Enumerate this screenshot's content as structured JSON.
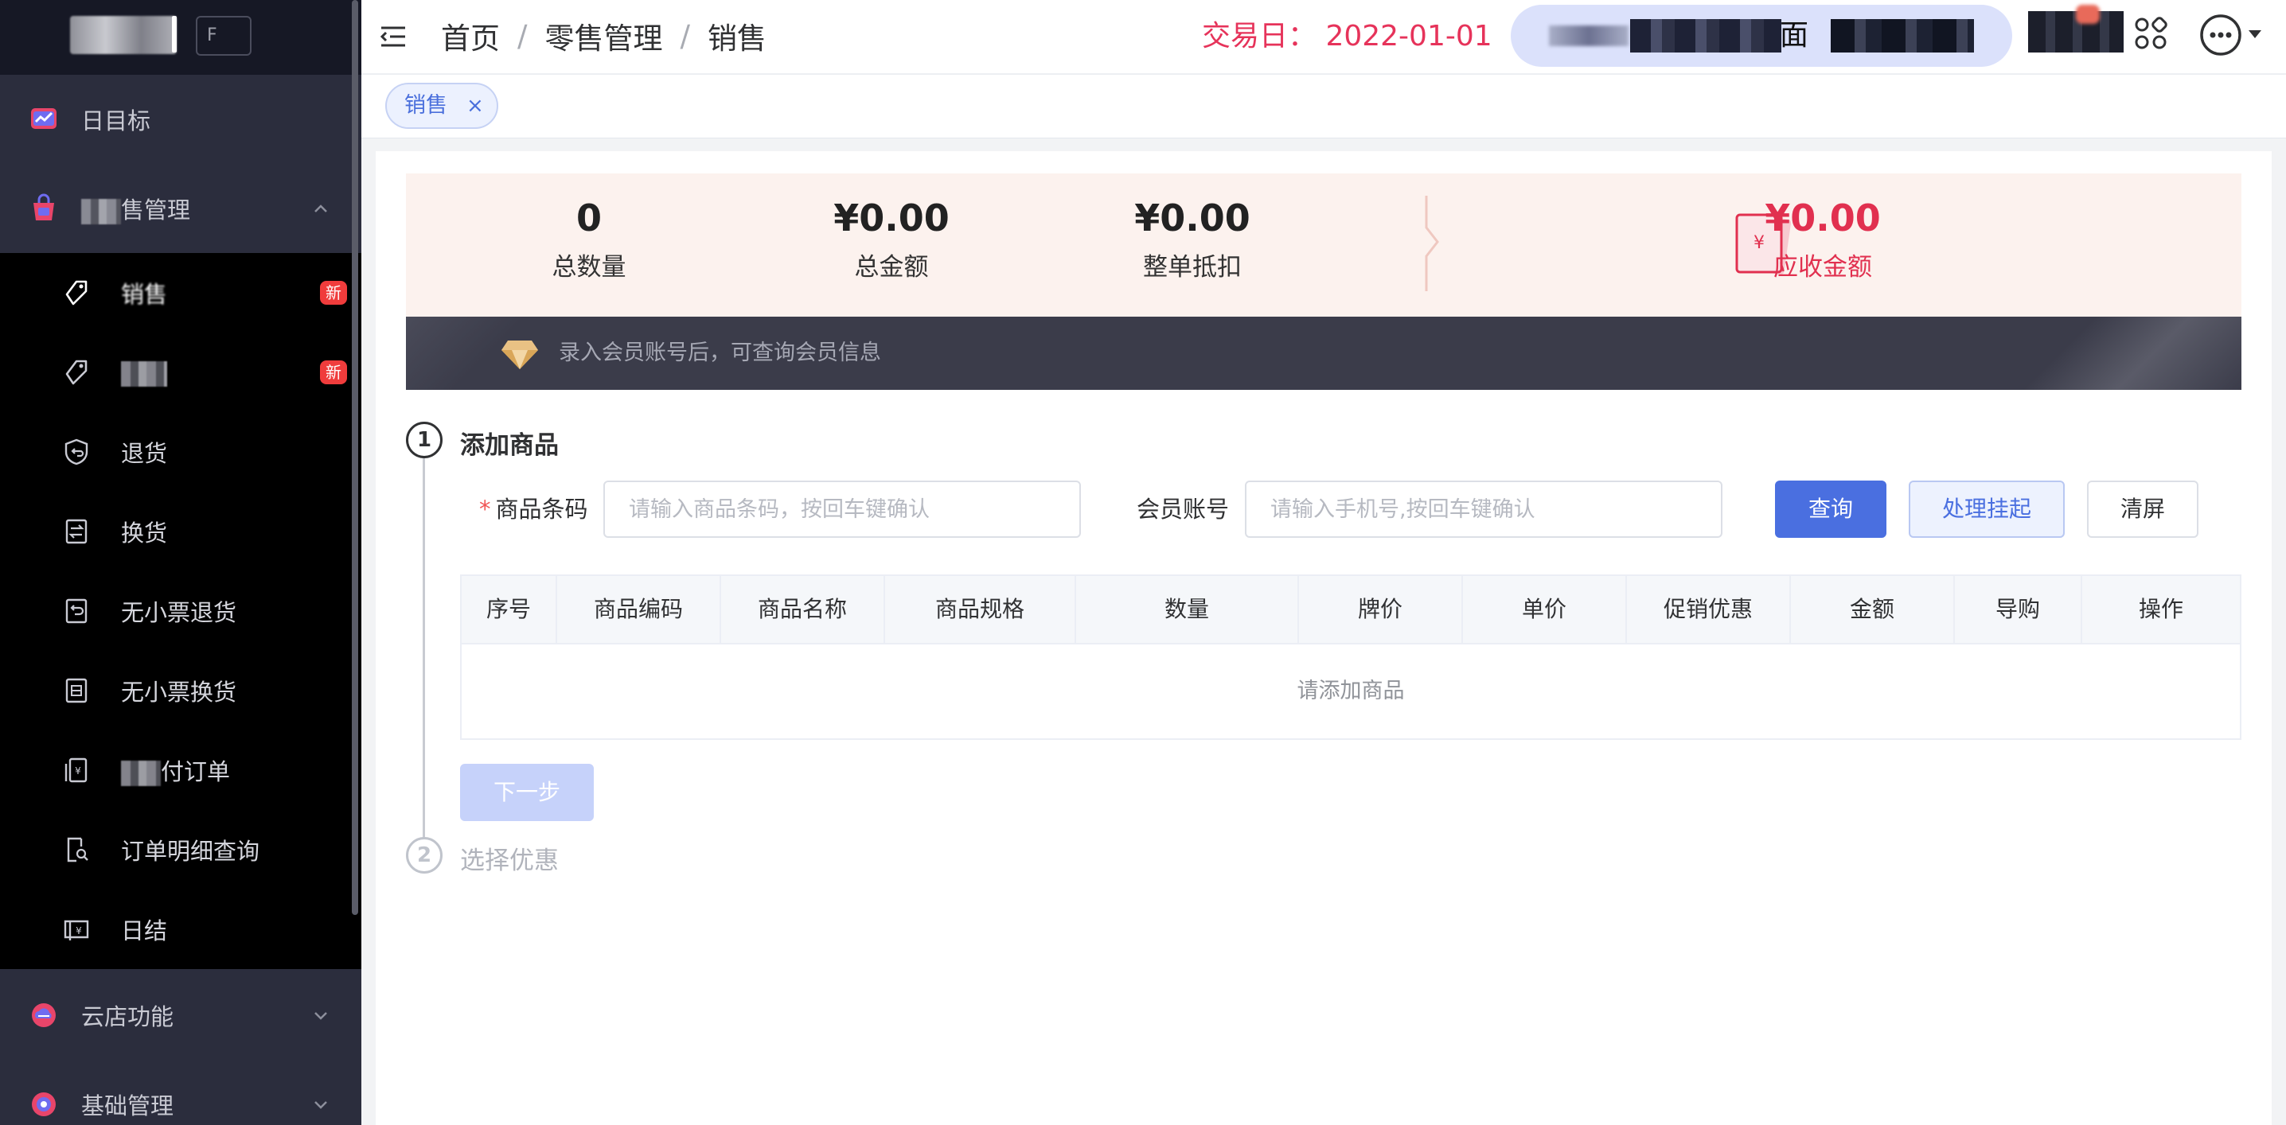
{
  "sidebar": {
    "env_label": "F",
    "top_items": [
      {
        "label": "日目标"
      },
      {
        "label": "售管理"
      }
    ],
    "sub_items": [
      {
        "label": "销售",
        "badge": "新"
      },
      {
        "label": "",
        "badge": "新"
      },
      {
        "label": "退货"
      },
      {
        "label": "换货"
      },
      {
        "label": "无小票退货"
      },
      {
        "label": "无小票换货"
      },
      {
        "label": "付订单"
      },
      {
        "label": "订单明细查询"
      },
      {
        "label": "日结"
      }
    ],
    "bottom_items": [
      {
        "label": "云店功能"
      },
      {
        "label": "基础管理"
      }
    ]
  },
  "header": {
    "breadcrumb": [
      "首页",
      "零售管理",
      "销售"
    ],
    "breadcrumb_sep": "/",
    "trade_day": "交易日： 2022-01-01",
    "store_text": "面"
  },
  "tags": {
    "active_tag": "销售",
    "close_glyph": "×"
  },
  "summary": {
    "total_qty": {
      "value": "0",
      "label": "总数量"
    },
    "total_amount": {
      "value": "¥0.00",
      "label": "总金额"
    },
    "order_discount": {
      "value": "¥0.00",
      "label": "整单抵扣"
    },
    "amount_due": {
      "value": "¥0.00",
      "label": "应收金额"
    },
    "receipt_symbol": "¥"
  },
  "member_bar": {
    "text": "录入会员账号后，可查询会员信息"
  },
  "steps": [
    {
      "number": "1",
      "title": "添加商品"
    },
    {
      "number": "2",
      "title": "选择优惠"
    }
  ],
  "form": {
    "barcode": {
      "required_mark": "*",
      "label": "商品条码",
      "placeholder": "请输入商品条码，按回车键确认",
      "value": ""
    },
    "member": {
      "label": "会员账号",
      "placeholder": "请输入手机号,按回车键确认",
      "value": ""
    },
    "query_btn": "查询",
    "suspend_btn": "处理挂起",
    "clear_btn": "清屏",
    "next_btn": "下一步"
  },
  "table": {
    "columns": [
      "序号",
      "商品编码",
      "商品名称",
      "商品规格",
      "数量",
      "牌价",
      "单价",
      "促销优惠",
      "金额",
      "导购",
      "操作"
    ],
    "empty_text": "请添加商品"
  },
  "colors": {
    "sidebar_bg": "#2b2d3d",
    "submenu_bg": "#000000",
    "accent": "#4a6fe0",
    "danger": "#e1304f",
    "summary_bg": "#fcf2ee",
    "member_bar_bg": "#3b3c4a"
  },
  "icons": {
    "hamburger": "menu-fold-icon",
    "apps": "apps-grid-icon",
    "more": "more-dots-icon",
    "receipt": "receipt-yen-icon",
    "diamond": "diamond-icon"
  }
}
